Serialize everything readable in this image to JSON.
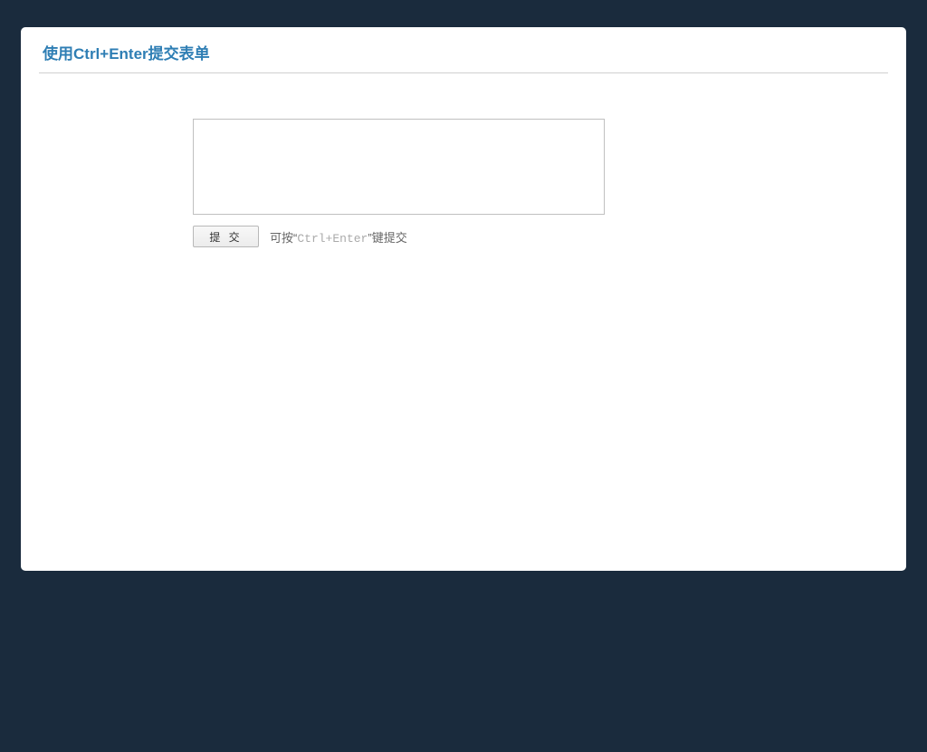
{
  "header": {
    "title": "使用Ctrl+Enter提交表单"
  },
  "form": {
    "textarea_value": "",
    "submit_label": "提 交",
    "hint_prefix": "可按“",
    "hint_key": "Ctrl+Enter",
    "hint_suffix": "”键提交"
  }
}
